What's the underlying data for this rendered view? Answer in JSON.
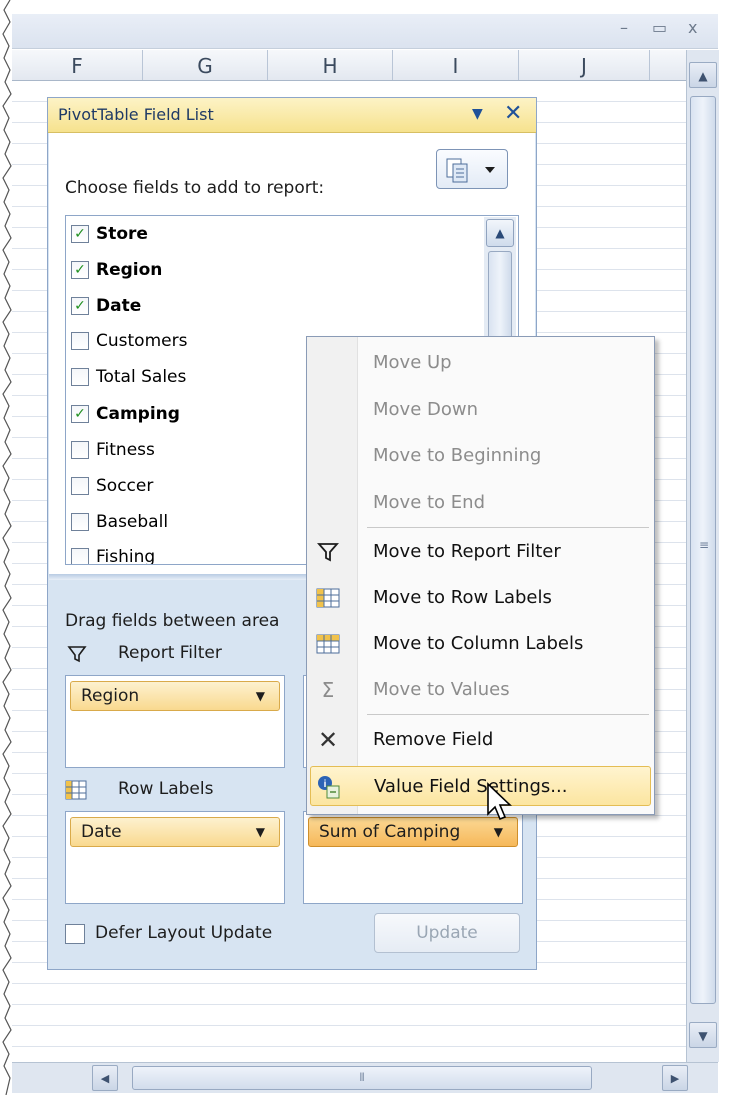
{
  "window": {
    "minimize_glyph": "–",
    "restore_glyph": "▭",
    "close_glyph": "x"
  },
  "columns": [
    "F",
    "G",
    "H",
    "I",
    "J"
  ],
  "pane": {
    "title": "PivotTable Field List",
    "dropdown_glyph": "▼",
    "close_glyph": "✕",
    "choose_label": "Choose fields to add to report:",
    "fields": [
      {
        "label": "Store",
        "checked": true
      },
      {
        "label": "Region",
        "checked": true
      },
      {
        "label": "Date",
        "checked": true
      },
      {
        "label": "Customers",
        "checked": false
      },
      {
        "label": "Total Sales",
        "checked": false
      },
      {
        "label": "Camping",
        "checked": true
      },
      {
        "label": "Fitness",
        "checked": false
      },
      {
        "label": "Soccer",
        "checked": false
      },
      {
        "label": "Baseball",
        "checked": false
      },
      {
        "label": "Fishing",
        "checked": false
      }
    ],
    "drag_label": "Drag fields between area",
    "report_filter_label": "Report Filter",
    "row_labels_label": "Row Labels",
    "report_filter_chip": "Region",
    "row_labels_chip": "Date",
    "values_chip": "Sum of Camping",
    "defer_label": "Defer Layout Update",
    "update_label": "Update"
  },
  "menu": {
    "items": [
      {
        "label": "Move Up",
        "enabled": false,
        "icon": ""
      },
      {
        "label": "Move Down",
        "enabled": false,
        "icon": ""
      },
      {
        "label": "Move to Beginning",
        "enabled": false,
        "icon": ""
      },
      {
        "label": "Move to End",
        "enabled": false,
        "icon": ""
      },
      {
        "label": "Move to Report Filter",
        "enabled": true,
        "icon": "filter-icon"
      },
      {
        "label": "Move to Row Labels",
        "enabled": true,
        "icon": "row-labels-icon"
      },
      {
        "label": "Move to Column Labels",
        "enabled": true,
        "icon": "column-labels-icon"
      },
      {
        "label": "Move to Values",
        "enabled": false,
        "icon": "sigma-icon"
      },
      {
        "label": "Remove Field",
        "enabled": true,
        "icon": "remove-icon"
      },
      {
        "label": "Value Field Settings...",
        "enabled": true,
        "icon": "field-settings-icon",
        "highlighted": true
      }
    ]
  },
  "colors": {
    "pane_bg": "#d7e4f2",
    "title_bg": "#f6e28e",
    "chip_bg": "#f9d98f",
    "checkmark": "#209020",
    "highlight": "#fce5a0"
  }
}
